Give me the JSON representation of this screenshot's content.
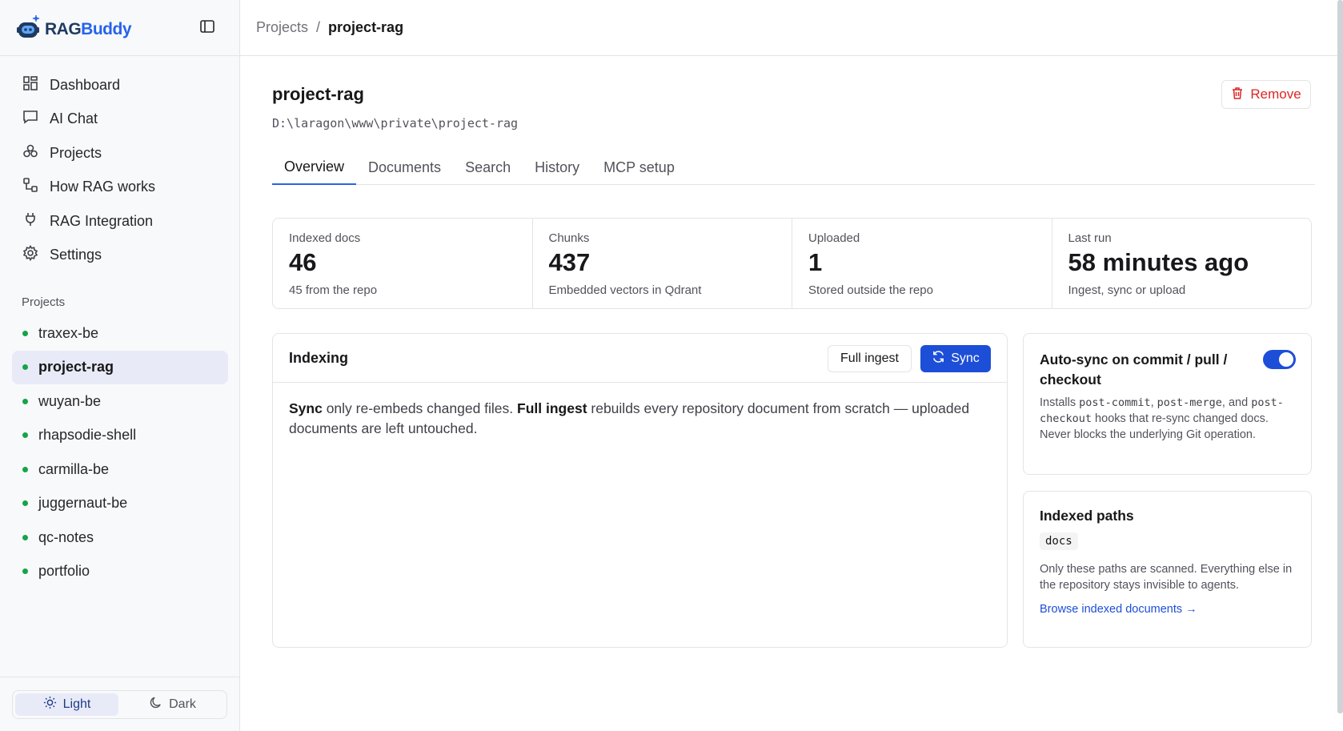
{
  "app": {
    "logo_rag": "RAG",
    "logo_buddy": "Buddy"
  },
  "sidebar": {
    "nav": [
      {
        "label": "Dashboard",
        "icon": "dashboard-icon"
      },
      {
        "label": "AI Chat",
        "icon": "chat-icon"
      },
      {
        "label": "Projects",
        "icon": "projects-icon"
      },
      {
        "label": "How RAG works",
        "icon": "workflow-icon"
      },
      {
        "label": "RAG Integration",
        "icon": "plug-icon"
      },
      {
        "label": "Settings",
        "icon": "gear-icon"
      }
    ],
    "projects_label": "Projects",
    "projects": [
      "traxex-be",
      "project-rag",
      "wuyan-be",
      "rhapsodie-shell",
      "carmilla-be",
      "juggernaut-be",
      "qc-notes",
      "portfolio"
    ],
    "active_project": "project-rag",
    "theme": {
      "light": "Light",
      "dark": "Dark",
      "selected": "Light"
    }
  },
  "header": {
    "breadcrumb_root": "Projects",
    "breadcrumb_sep": "/",
    "breadcrumb_current": "project-rag"
  },
  "project": {
    "name": "project-rag",
    "path": "D:\\laragon\\www\\private\\project-rag",
    "remove_label": "Remove"
  },
  "tabs": [
    "Overview",
    "Documents",
    "Search",
    "History",
    "MCP setup"
  ],
  "active_tab": "Overview",
  "stats": [
    {
      "label": "Indexed docs",
      "value": "46",
      "sub": "45 from the repo"
    },
    {
      "label": "Chunks",
      "value": "437",
      "sub": "Embedded vectors in Qdrant"
    },
    {
      "label": "Uploaded",
      "value": "1",
      "sub": "Stored outside the repo"
    },
    {
      "label": "Last run",
      "value": "58 minutes ago",
      "sub": "Ingest, sync or upload"
    }
  ],
  "indexing": {
    "title": "Indexing",
    "full_ingest_label": "Full ingest",
    "sync_label": "Sync",
    "desc_b1": "Sync",
    "desc_t1": " only re-embeds changed files. ",
    "desc_b2": "Full ingest",
    "desc_t2": " rebuilds every repository document from scratch — uploaded documents are left untouched."
  },
  "autosync": {
    "title": "Auto-sync on commit / pull / checkout",
    "enabled": true,
    "desc_1": "Installs ",
    "hook_1": "post-commit",
    "desc_2": ", ",
    "hook_2": "post-merge",
    "desc_3": ", and ",
    "hook_3": "post-checkout",
    "desc_4": " hooks that re-sync changed docs. Never blocks the underlying Git operation."
  },
  "indexed_paths": {
    "title": "Indexed paths",
    "paths": [
      "docs"
    ],
    "desc": "Only these paths are scanned. Everything else in the repository stays invisible to agents.",
    "link": "Browse indexed documents →"
  },
  "colors": {
    "accent": "#1d4ed8",
    "danger": "#dc2626",
    "status_dot": "#16a34a",
    "active_bg": "#e8ebf7"
  }
}
